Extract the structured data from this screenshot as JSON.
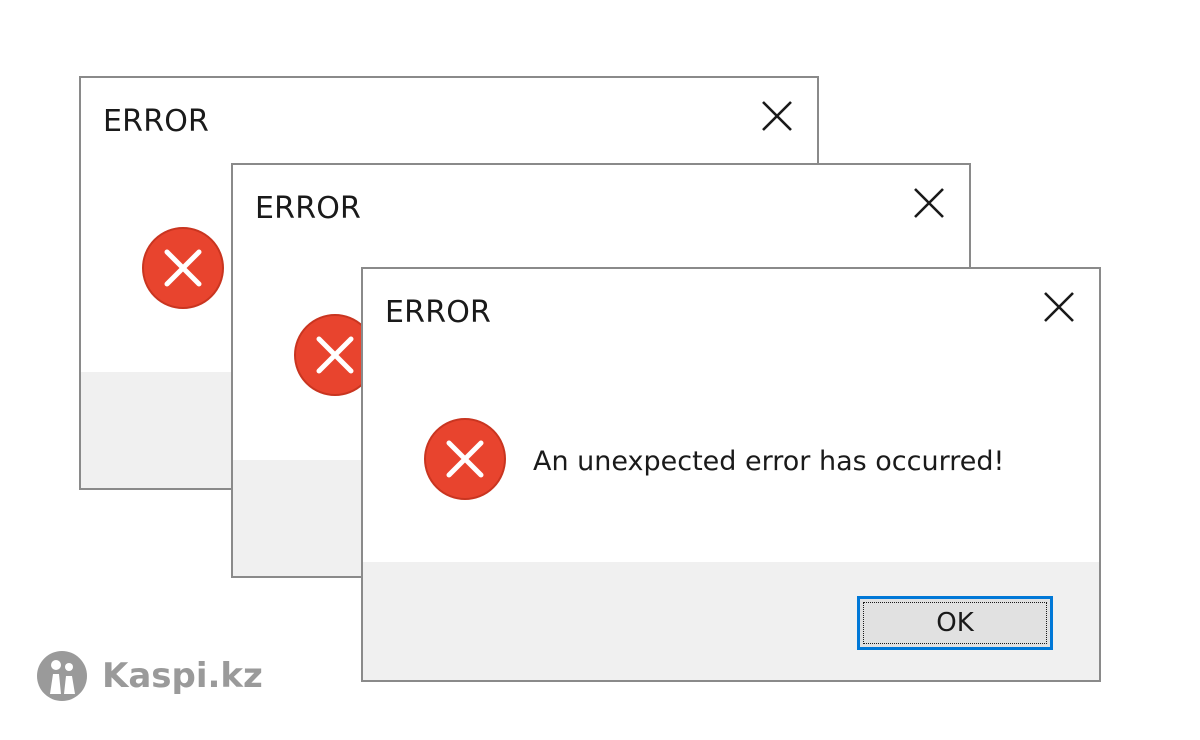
{
  "dialogs": [
    {
      "title": "ERROR"
    },
    {
      "title": "ERROR"
    },
    {
      "title": "ERROR",
      "message": "An unexpected error has occurred!",
      "ok_label": "OK"
    }
  ],
  "icons": {
    "error": "error-x-circle-icon",
    "close": "close-x-icon"
  },
  "colors": {
    "error_red": "#e8442e",
    "focus_blue": "#0078d7",
    "footer_gray": "#f0f0f0",
    "watermark_gray": "#9a9a9a"
  },
  "watermark": {
    "text": "Kaspi.kz"
  }
}
